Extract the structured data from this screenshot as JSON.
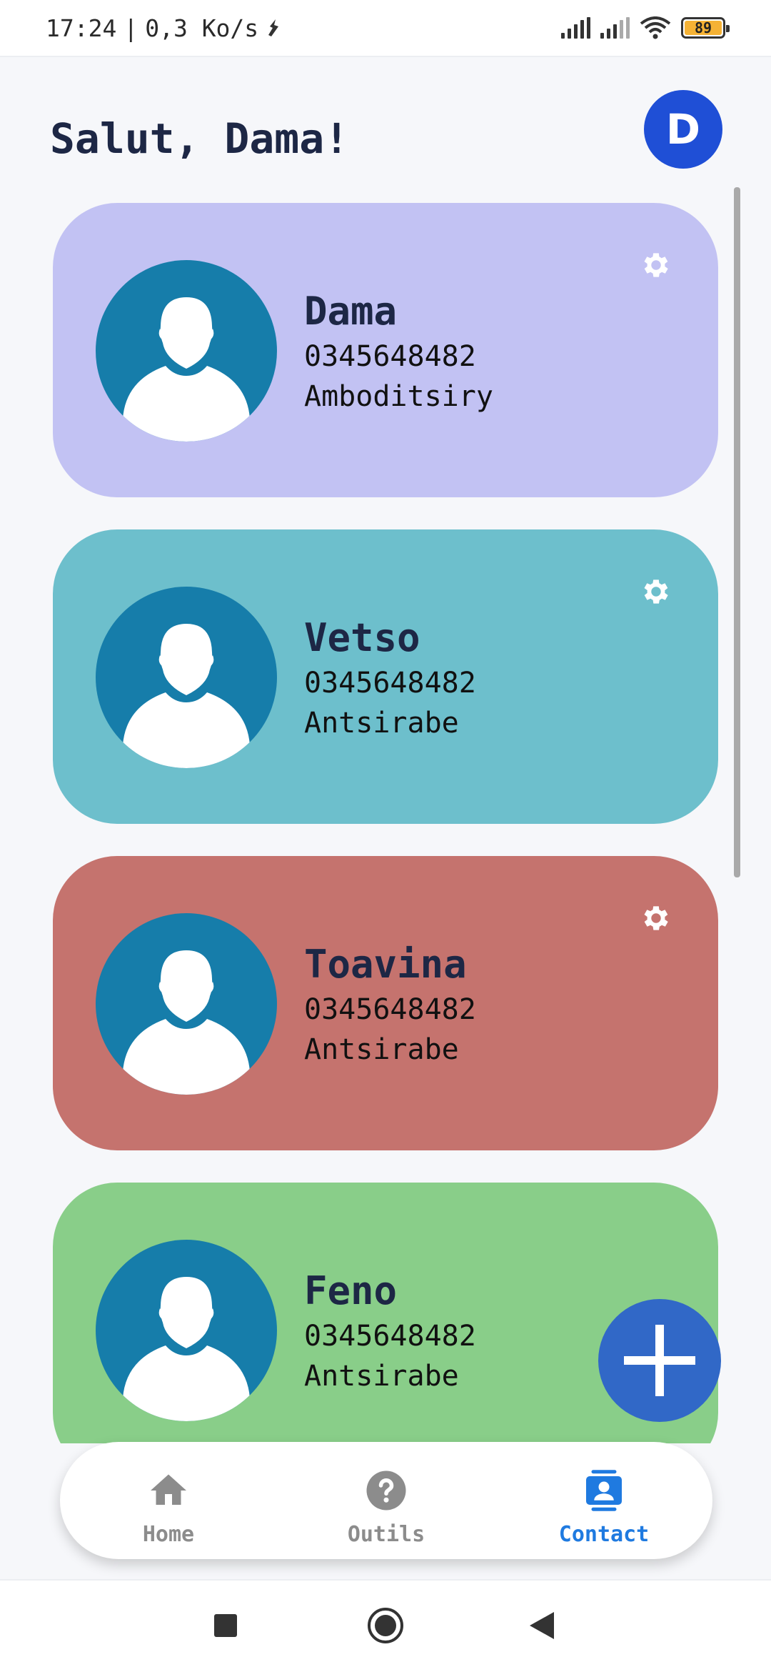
{
  "status_bar": {
    "time": "17:24",
    "separator": "|",
    "speed": "0,3 Ko/s",
    "battery": "89",
    "battery_color": "#f5b235"
  },
  "header": {
    "greeting": "Salut, Dama!",
    "avatar_initial": "D",
    "avatar_color": "#1f4fd6"
  },
  "contacts": [
    {
      "name": "Dama",
      "phone": "0345648482",
      "city": "Amboditsiry",
      "color": "#c2c2f3"
    },
    {
      "name": "Vetso",
      "phone": "0345648482",
      "city": "Antsirabe",
      "color": "#6dbfcc"
    },
    {
      "name": "Toavina",
      "phone": "0345648482",
      "city": "Antsirabe",
      "color": "#c5736e"
    },
    {
      "name": "Feno",
      "phone": "0345648482",
      "city": "Antsirabe",
      "color": "#89ce89"
    }
  ],
  "fab": {
    "icon": "plus-icon",
    "color": "#3168c7"
  },
  "bottom_nav": {
    "items": [
      {
        "label": "Home",
        "icon": "home-icon",
        "active": false
      },
      {
        "label": "Outils",
        "icon": "help-icon",
        "active": false
      },
      {
        "label": "Contact",
        "icon": "contact-icon",
        "active": true
      }
    ],
    "active_color": "#1f7ae0",
    "inactive_color": "#8c8c8c"
  },
  "system_nav": {
    "items": [
      "recents-icon",
      "home-circle-icon",
      "back-icon"
    ]
  }
}
